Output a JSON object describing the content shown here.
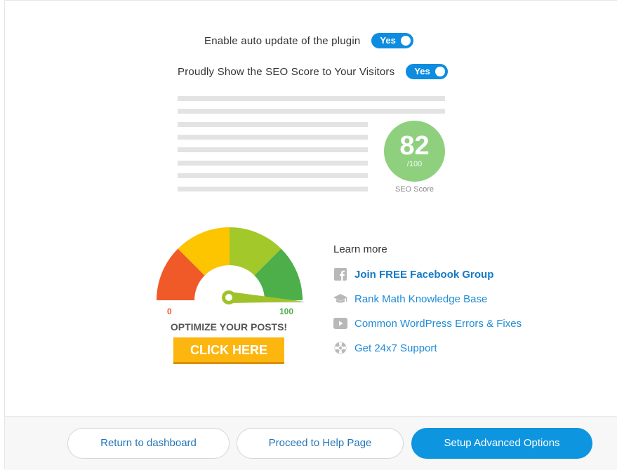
{
  "settings": {
    "auto_update": {
      "label": "Enable auto update of the plugin",
      "value": "Yes"
    },
    "show_score": {
      "label": "Proudly Show the SEO Score to Your Visitors",
      "value": "Yes"
    }
  },
  "preview": {
    "score": "82",
    "score_max": "/100",
    "score_caption": "SEO Score"
  },
  "promo": {
    "gauge_min": "0",
    "gauge_max": "100",
    "headline": "OPTIMIZE YOUR POSTS!",
    "cta": "CLICK HERE"
  },
  "learn_more": {
    "title": "Learn more",
    "links": [
      {
        "label": "Join FREE Facebook Group",
        "icon": "facebook-icon"
      },
      {
        "label": "Rank Math Knowledge Base",
        "icon": "graduation-cap-icon"
      },
      {
        "label": "Common WordPress Errors & Fixes",
        "icon": "youtube-icon"
      },
      {
        "label": "Get 24x7 Support",
        "icon": "lifebuoy-icon"
      }
    ]
  },
  "footer": {
    "return_label": "Return to dashboard",
    "help_label": "Proceed to Help Page",
    "advanced_label": "Setup Advanced Options"
  },
  "colors": {
    "toggle_on": "#0e8de0",
    "score_green": "#8fd07f",
    "link_blue": "#1e8bd6",
    "cta_yellow": "#fcb60f",
    "primary_button": "#0e95e0"
  }
}
